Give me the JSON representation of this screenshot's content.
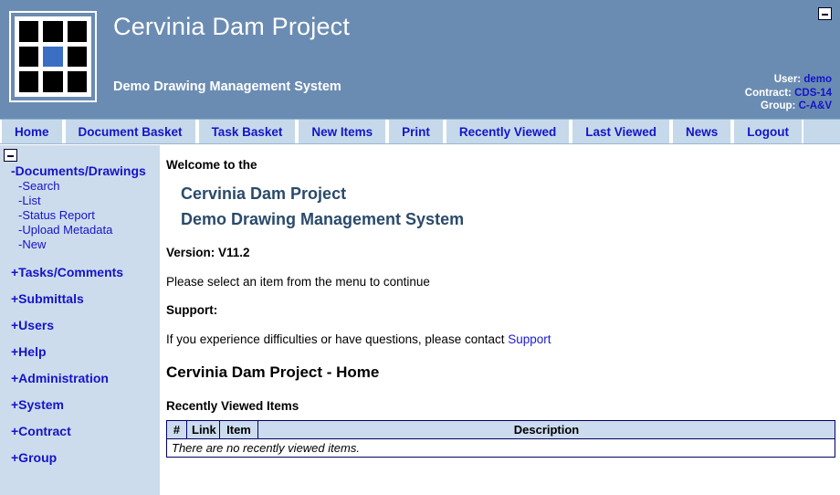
{
  "header": {
    "title": "Cervinia Dam Project",
    "subtitle": "Demo Drawing Management System",
    "minimize_icon": "minimize-icon",
    "logo": {
      "name": "grid-logo-icon",
      "cells": [
        "black",
        "black",
        "black",
        "black",
        "accent",
        "black",
        "black",
        "black",
        "black"
      ],
      "accent_color": "#3a6fc4"
    },
    "user_info": {
      "user_label": "User:",
      "user_value": "demo",
      "contract_label": "Contract:",
      "contract_value": "CDS-14",
      "group_label": "Group:",
      "group_value": "C-A&V"
    },
    "background_color": "#6b8cb2",
    "text_color": "#ffffff",
    "value_color": "#1414c8"
  },
  "nav": {
    "items": [
      {
        "label": "Home"
      },
      {
        "label": "Document Basket"
      },
      {
        "label": "Task Basket"
      },
      {
        "label": "New Items"
      },
      {
        "label": "Print"
      },
      {
        "label": "Recently Viewed"
      },
      {
        "label": "Last Viewed"
      },
      {
        "label": "News"
      },
      {
        "label": "Logout"
      }
    ],
    "background_color": "#c6d9ea",
    "link_color": "#1414c8"
  },
  "sidebar": {
    "minimize_icon": "minimize-icon",
    "background_color": "#cddcec",
    "tree": [
      {
        "label": "-Documents/Drawings",
        "expanded": true
      },
      {
        "label": "-Search"
      },
      {
        "label": "-List"
      },
      {
        "label": "-Status Report"
      },
      {
        "label": "-Upload Metadata"
      },
      {
        "label": "-New"
      },
      {
        "label": "+Tasks/Comments",
        "expanded": false
      },
      {
        "label": "+Submittals",
        "expanded": false
      },
      {
        "label": "+Users",
        "expanded": false
      },
      {
        "label": "+Help",
        "expanded": false
      },
      {
        "label": "+Administration",
        "expanded": false
      },
      {
        "label": "+System",
        "expanded": false
      },
      {
        "label": "+Contract",
        "expanded": false
      },
      {
        "label": "+Group",
        "expanded": false
      }
    ]
  },
  "content": {
    "welcome": "Welcome to the",
    "heading_line1": "Cervinia Dam Project",
    "heading_line2": "Demo Drawing Management System",
    "version": "Version: V11.2",
    "instruction": "Please select an item from the menu to continue",
    "support_label": "Support:",
    "support_text": "If you experience difficulties or have questions, please contact ",
    "support_link": "Support",
    "page_heading": "Cervinia Dam Project - Home",
    "section_label": "Recently Viewed Items",
    "heading_color": "#2a4a6b",
    "link_color": "#1a1ad2"
  },
  "recent_table": {
    "columns": [
      "#",
      "Link",
      "Item",
      "Description"
    ],
    "empty_message": "There are no recently viewed items.",
    "rows": [],
    "header_background": "#ccdcee",
    "border_color": "#000066"
  }
}
